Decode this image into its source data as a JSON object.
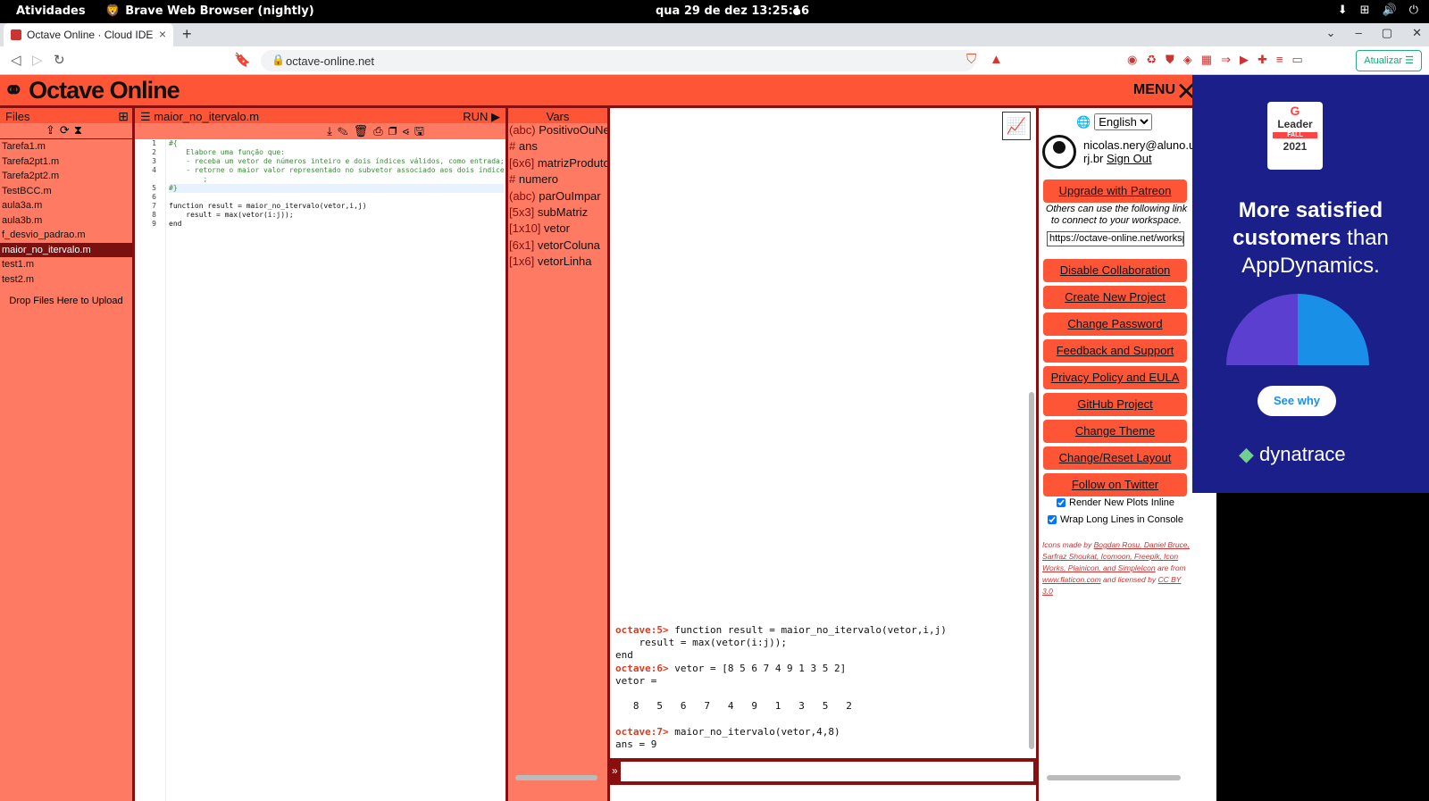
{
  "system_bar": {
    "activities": "Atividades",
    "app_name": "Brave Web Browser (nightly)",
    "clock": "qua 29 de dez  13:25:16"
  },
  "browser": {
    "tab_title": "Octave Online · Cloud IDE",
    "url": "octave-online.net",
    "update_label": "Atualizar"
  },
  "app": {
    "logo": "Octave Online",
    "menu_label": "MENU"
  },
  "files": {
    "title": "Files",
    "items": [
      "Tarefa1.m",
      "Tarefa2pt1.m",
      "Tarefa2pt2.m",
      "TestBCC.m",
      "aula3a.m",
      "aula3b.m",
      "f_desvio_padrao.m",
      "maior_no_itervalo.m",
      "test1.m",
      "test2.m"
    ],
    "selected": "maior_no_itervalo.m",
    "drop_label": "Drop Files Here to Upload"
  },
  "editor": {
    "filename": "maior_no_itervalo.m",
    "run_label": "RUN ▶",
    "lines": [
      "#{",
      "    Elabore uma função que:",
      "    - receba um vetor de números inteiro e dois índices válidos, como entrada;",
      "    - retorne o maior valor representado no subvetor associado aos dois índices",
      "        ;",
      "#}",
      "",
      "function result = maior_no_itervalo(vetor,i,j)",
      "    result = max(vetor(i:j));",
      "end"
    ],
    "line_numbers": [
      "1",
      "2",
      "3",
      "4",
      "",
      "5",
      "6",
      "7",
      "8",
      "9"
    ]
  },
  "vars": {
    "title": "Vars",
    "items": [
      {
        "type": "(abc)",
        "name": "PositivoOuNegativo"
      },
      {
        "type": "#",
        "name": "ans"
      },
      {
        "type": "[6x6]",
        "name": "matrizProduto"
      },
      {
        "type": "#",
        "name": "numero"
      },
      {
        "type": "(abc)",
        "name": "parOuImpar"
      },
      {
        "type": "[5x3]",
        "name": "subMatriz"
      },
      {
        "type": "[1x10]",
        "name": "vetor"
      },
      {
        "type": "[6x1]",
        "name": "vetorColuna"
      },
      {
        "type": "[1x6]",
        "name": "vetorLinha"
      }
    ]
  },
  "console": {
    "lines": [
      {
        "prompt": "octave:5>",
        "text": " function result = maior_no_itervalo(vetor,i,j)"
      },
      {
        "prompt": "",
        "text": "    result = max(vetor(i:j));"
      },
      {
        "prompt": "",
        "text": "end"
      },
      {
        "prompt": "octave:6>",
        "text": " vetor = [8 5 6 7 4 9 1 3 5 2]"
      },
      {
        "prompt": "",
        "text": "vetor ="
      },
      {
        "prompt": "",
        "text": ""
      },
      {
        "prompt": "",
        "text": "   8   5   6   7   4   9   1   3   5   2"
      },
      {
        "prompt": "",
        "text": ""
      },
      {
        "prompt": "octave:7>",
        "text": " maior_no_itervalo(vetor,4,8)"
      },
      {
        "prompt": "",
        "text": "ans = 9"
      }
    ]
  },
  "menu": {
    "language": "English",
    "user_email": "nicolas.nery@aluno.ufop.edu.br",
    "user_line2": "rj.br",
    "sign_out": "Sign Out",
    "upgrade": "Upgrade with Patreon",
    "share_note": "Others can use the following link to connect to your workspace.",
    "share_url": "https://octave-online.net/workspace~",
    "buttons": [
      "Disable Collaboration",
      "Create New Project",
      "Change Password",
      "Feedback and Support",
      "Privacy Policy and EULA",
      "GitHub Project",
      "Change Theme",
      "Change/Reset Layout",
      "Follow on Twitter"
    ],
    "check_plots": "Render New Plots Inline",
    "check_wrap": "Wrap Long Lines in Console",
    "credits_prefix": "Icons made by ",
    "credits_authors": "Bogdan Rosu, Daniel Bruce, Sarfraz Shoukat, Icomoon, Freepik, Icon Works, Plainicon, and SimpleIcon",
    "credits_mid": " are from ",
    "credits_site": "www.flaticon.com",
    "credits_lic_prefix": " and licensed by ",
    "credits_lic": "CC BY 3.0"
  },
  "ad": {
    "badge_top": "Leader",
    "badge_season": "FALL",
    "badge_year": "2021",
    "headline_bold": "More satisfied customers",
    "headline_rest": "than AppDynamics.",
    "cta": "See why",
    "brand": "dynatrace"
  },
  "colors": {
    "primary": "#fe5536",
    "panel": "#ff7a62",
    "dark": "#8a0e0e",
    "ad_bg": "#1b1f8a"
  }
}
